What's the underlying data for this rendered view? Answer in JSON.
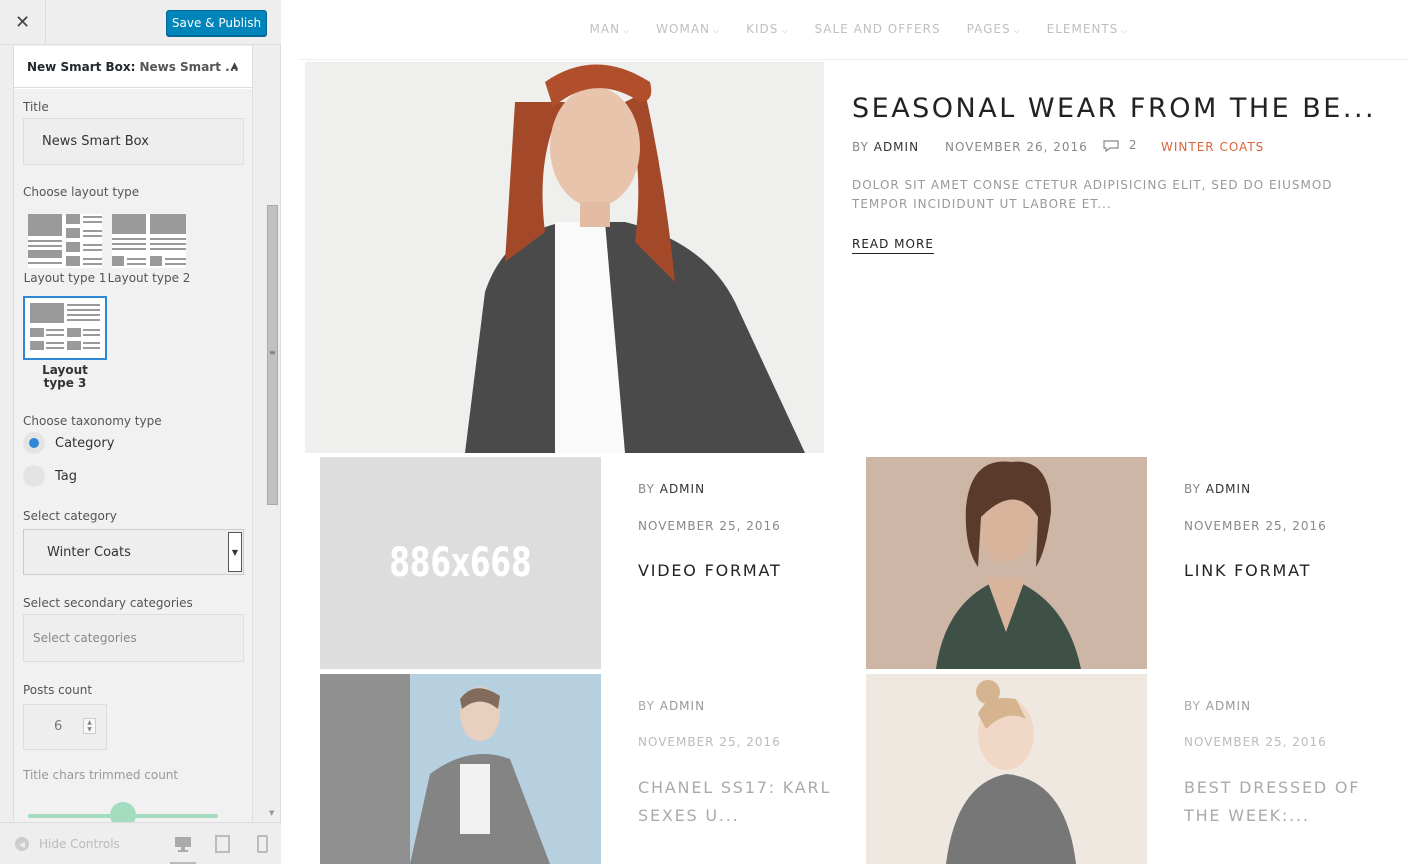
{
  "sidebar": {
    "close_glyph": "✕",
    "publish_label": "Save & Publish",
    "panel_title": "New Smart Box:",
    "panel_subtitle": "News Smart ...",
    "title_label": "Title",
    "title_value": "News Smart Box",
    "layout_label": "Choose layout type",
    "layouts": [
      {
        "label": "Layout type 1"
      },
      {
        "label": "Layout type 2"
      },
      {
        "label": "Layout type 3"
      }
    ],
    "taxonomy_label": "Choose taxonomy type",
    "taxonomy_options": [
      {
        "label": "Category",
        "checked": true
      },
      {
        "label": "Tag",
        "checked": false
      }
    ],
    "category_label": "Select category",
    "category_value": "Winter Coats",
    "secondary_label": "Select secondary categories",
    "secondary_placeholder": "Select categories",
    "posts_label": "Posts count",
    "posts_value": "6",
    "trim_label": "Title chars trimmed count",
    "hide_controls_label": "Hide Controls"
  },
  "nav": {
    "items": [
      {
        "label": "MAN"
      },
      {
        "label": "WOMAN"
      },
      {
        "label": "KIDS"
      },
      {
        "label": "SALE AND OFFERS"
      },
      {
        "label": "PAGES"
      },
      {
        "label": "ELEMENTS"
      }
    ]
  },
  "hero": {
    "title": "SEASONAL WEAR FROM THE BE...",
    "by": "BY",
    "author": "ADMIN",
    "date": "NOVEMBER 26, 2016",
    "comments": "2",
    "category": "WINTER COATS",
    "excerpt": "DOLOR SIT AMET CONSE CTETUR ADIPISICING ELIT, SED DO EIUSMOD TEMPOR INCIDIDUNT UT LABORE ET...",
    "read_more": "READ MORE"
  },
  "cards": [
    {
      "by": "BY",
      "author": "ADMIN",
      "date": "NOVEMBER 25, 2016",
      "title": "VIDEO FORMAT",
      "placeholder": "886x668"
    },
    {
      "by": "BY",
      "author": "ADMIN",
      "date": "NOVEMBER 25, 2016",
      "title": "LINK FORMAT"
    },
    {
      "by": "BY",
      "author": "ADMIN",
      "date": "NOVEMBER 25, 2016",
      "title_line1": "CHANEL SS17: KARL",
      "title_line2": "SEXES U..."
    },
    {
      "by": "BY",
      "author": "ADMIN",
      "date": "NOVEMBER 25, 2016",
      "title_line1": "BEST DRESSED OF",
      "title_line2": "THE WEEK:..."
    }
  ],
  "colors": {
    "accent": "#0085ba",
    "selection": "#2f87d8",
    "category": "#d9643a",
    "slider": "#a4dcc0"
  }
}
